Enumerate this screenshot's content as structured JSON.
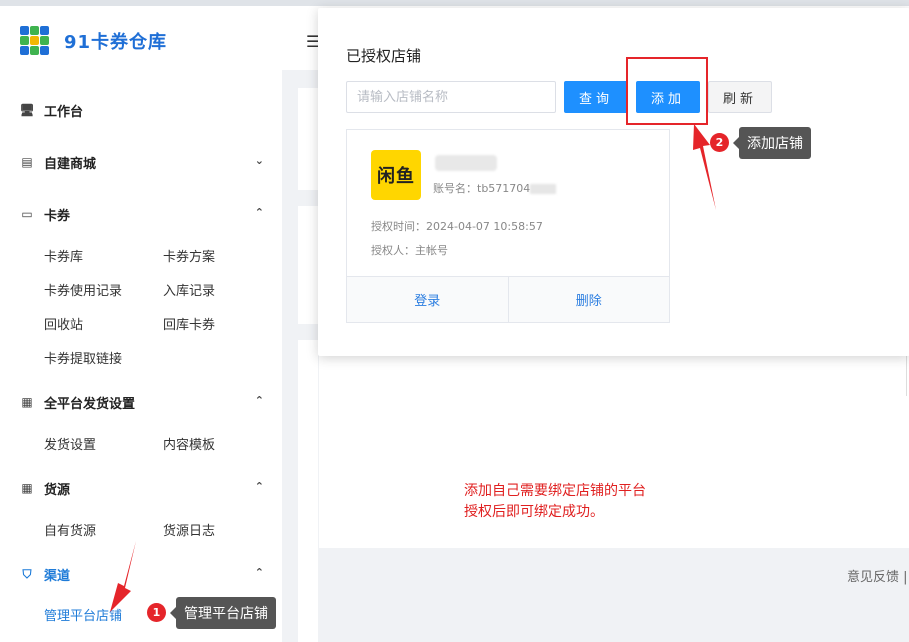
{
  "app": {
    "logo_text": "91卡券仓库"
  },
  "sidebar": {
    "workbench": "工作台",
    "mall": "自建商城",
    "coupon": {
      "label": "卡券",
      "items": [
        "卡券库",
        "卡券方案",
        "卡券使用记录",
        "入库记录",
        "回收站",
        "回库卡券",
        "卡券提取链接"
      ]
    },
    "shipping": {
      "label": "全平台发货设置",
      "items": [
        "发货设置",
        "内容模板"
      ]
    },
    "source": {
      "label": "货源",
      "items": [
        "自有货源",
        "货源日志"
      ]
    },
    "channel": {
      "label": "渠道",
      "items": [
        "管理平台店铺"
      ]
    }
  },
  "popover": {
    "title": "已授权店铺",
    "search_placeholder": "请输入店铺名称",
    "query_label": "查询",
    "add_label": "添加",
    "refresh_label": "刷新",
    "shop": {
      "logo_text": "闲鱼",
      "account_label": "账号名：",
      "account_value": "tb571704",
      "auth_time_label": "授权时间：",
      "auth_time_value": "2024-04-07 10:58:57",
      "auth_person_label": "授权人：",
      "auth_person_value": "主帐号",
      "login_label": "登录",
      "delete_label": "删除"
    }
  },
  "main": {
    "feedback": "意见反馈 |"
  },
  "annotations": {
    "step1_number": "1",
    "step1_text": "管理平台店铺",
    "step2_number": "2",
    "step2_text": "添加店铺",
    "note_line1": "添加自己需要绑定店铺的平台",
    "note_line2": "授权后即可绑定成功。"
  },
  "colors": {
    "brand": "#1f6fd6",
    "primary_button": "#1e90ff",
    "highlight": "#e5252a",
    "xianyu_yellow": "#ffd600"
  }
}
